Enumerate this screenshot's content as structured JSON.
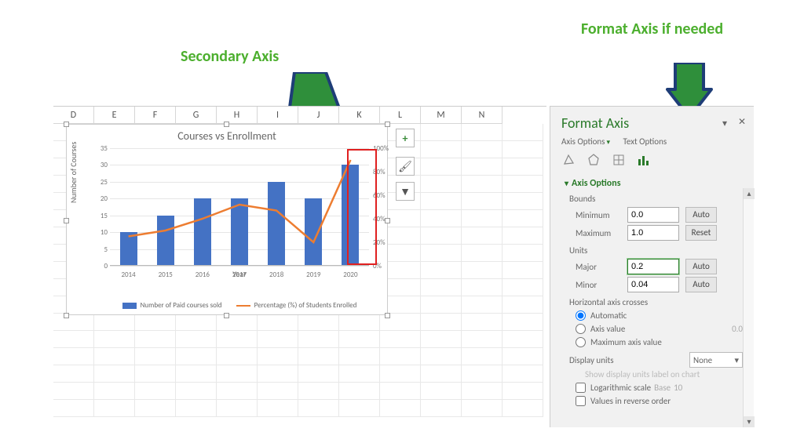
{
  "callouts": {
    "right": "Format Axis if needed",
    "left": "Secondary Axis"
  },
  "columns": [
    "D",
    "E",
    "F",
    "G",
    "H",
    "I",
    "J",
    "K",
    "L",
    "M",
    "N"
  ],
  "chart_tools": {
    "plus": "+",
    "brush": "✎",
    "funnel": "▾"
  },
  "chart": {
    "title": "Courses vs Enrollment",
    "y_label": "Number of Courses",
    "x_label": "Year",
    "legend_bar": "Number of Paid courses sold",
    "legend_line": "Percentage (%) of Students Enrolled"
  },
  "chart_data": {
    "type": "bar",
    "categories": [
      "2014",
      "2015",
      "2016",
      "2017",
      "2018",
      "2019",
      "2020"
    ],
    "series": [
      {
        "name": "Number of Paid courses sold",
        "type": "bar",
        "axis": "y",
        "values": [
          10,
          15,
          20,
          20,
          25,
          20,
          30
        ]
      },
      {
        "name": "Percentage (%) of Students Enrolled",
        "type": "line",
        "axis": "y2",
        "values": [
          25,
          30,
          40,
          52,
          47,
          20,
          90
        ]
      }
    ],
    "title": "Courses vs Enrollment",
    "xlabel": "Year",
    "ylabel": "Number of Courses",
    "ylim": [
      0,
      35
    ],
    "yticks": [
      0,
      5,
      10,
      15,
      20,
      25,
      30,
      35
    ],
    "y2lim": [
      0,
      100
    ],
    "y2ticks": [
      0,
      20,
      40,
      60,
      80,
      100
    ],
    "y2_format": "percent"
  },
  "y_ticks_labels": [
    "35",
    "30",
    "25",
    "20",
    "15",
    "10",
    "5",
    "0"
  ],
  "y2_ticks_labels": [
    "100%",
    "80%",
    "60%",
    "40%",
    "20%",
    "0%"
  ],
  "pane": {
    "title": "Format Axis",
    "tab1": "Axis Options",
    "tab2": "Text Options",
    "sec_axis_options": "Axis Options",
    "bounds": "Bounds",
    "minimum": "Minimum",
    "minimum_val": "0.0",
    "auto": "Auto",
    "maximum": "Maximum",
    "maximum_val": "1.0",
    "reset": "Reset",
    "units": "Units",
    "major": "Major",
    "major_val": "0.2",
    "minor": "Minor",
    "minor_val": "0.04",
    "hcross": "Horizontal axis crosses",
    "r_auto": "Automatic",
    "r_axisval": "Axis value",
    "r_axisval_num": "0.0",
    "r_maxval": "Maximum axis value",
    "display_units": "Display units",
    "display_units_val": "None",
    "show_disp": "Show display units label on chart",
    "logscale": "Logarithmic scale",
    "base": "Base",
    "base_val": "10",
    "reverse": "Values in reverse order"
  }
}
